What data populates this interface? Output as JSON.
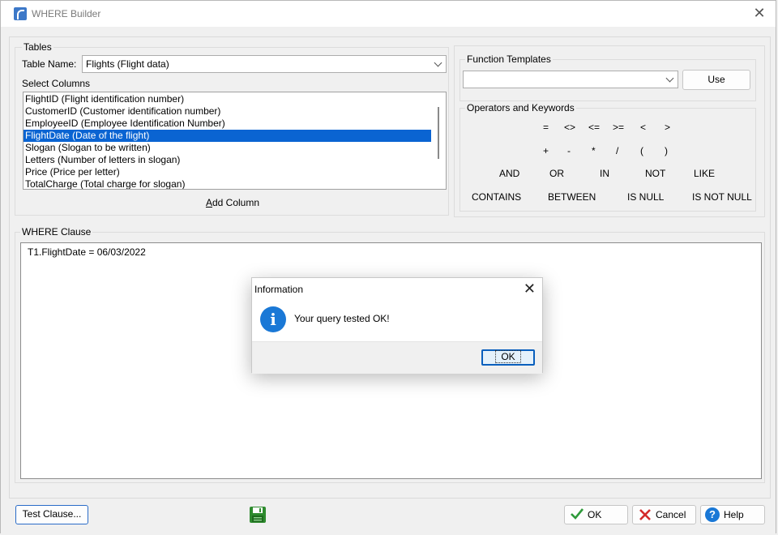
{
  "window": {
    "title": "WHERE Builder"
  },
  "tables": {
    "group_label": "Tables",
    "table_name_label": "Table Name:",
    "table_name_value": "Flights  (Flight data)",
    "select_columns_label": "Select Columns",
    "columns": [
      "FlightID  (Flight identification number)",
      "CustomerID  (Customer identification number)",
      "EmployeeID  (Employee Identification Number)",
      "FlightDate  (Date of the flight)",
      "Slogan  (Slogan to be written)",
      "Letters  (Number of letters in slogan)",
      "Price  (Price per letter)",
      "TotalCharge  (Total charge for slogan)"
    ],
    "selected_index": 3,
    "add_column_prefix": "A",
    "add_column_rest": "dd Column"
  },
  "function_templates": {
    "group_label": "Function Templates",
    "selected_value": "",
    "use_label": "Use"
  },
  "operators": {
    "group_label": "Operators and Keywords",
    "row1": [
      "=",
      "<>",
      "<=",
      ">=",
      "<",
      ">"
    ],
    "row2": [
      "+",
      "-",
      "*",
      "/",
      "(",
      ")"
    ],
    "row3": [
      "AND",
      "OR",
      "IN",
      "NOT",
      "LIKE"
    ],
    "row4": [
      "CONTAINS",
      "BETWEEN",
      "IS NULL",
      "IS NOT NULL"
    ]
  },
  "where_clause": {
    "group_label": "WHERE Clause",
    "text": "T1.FlightDate  = 06/03/2022"
  },
  "dialog": {
    "title": "Information",
    "message": "Your query tested OK!",
    "icon": "info-icon",
    "ok_label": "OK"
  },
  "footer": {
    "test_clause_label": "Test Clause...",
    "save_icon": "save-disk-icon",
    "ok_label": "OK",
    "cancel_label": "Cancel",
    "help_label": "Help"
  },
  "colors": {
    "selection": "#0a64d2",
    "save_icon": "#2e8b2e",
    "ok_check": "#2e9a3a",
    "cancel_x": "#d42a2a",
    "help_icon": "#1a78d6"
  }
}
